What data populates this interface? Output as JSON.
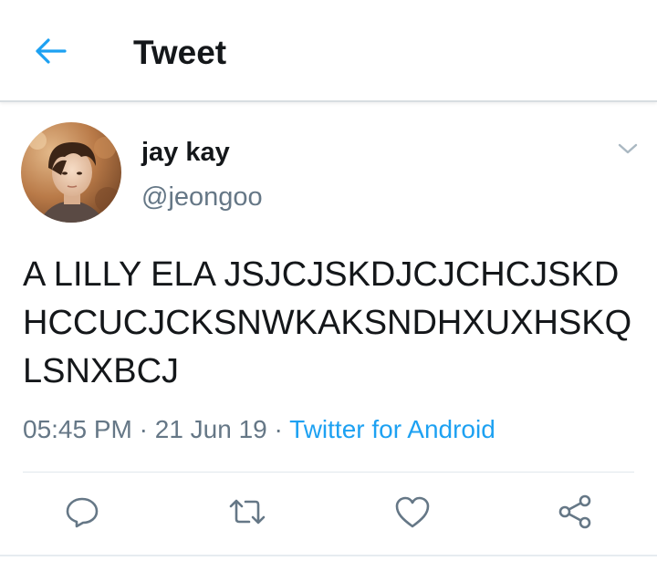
{
  "header": {
    "back_icon": "arrow-left-icon",
    "title": "Tweet"
  },
  "tweet": {
    "author": {
      "display_name": "jay kay",
      "handle": "@jeongoo",
      "avatar": "profile-photo"
    },
    "text": "A LILLY ELA JSJCJSKDJCJCHCJSKDHCCUCJCKSNWKAKSNDHXUXHSKQLSNXBCJ",
    "time": "05:45 PM",
    "separator": " · ",
    "date": "21 Jun 19",
    "source": "Twitter for Android",
    "menu_icon": "chevron-down-icon"
  },
  "actions": [
    {
      "icon": "reply-icon"
    },
    {
      "icon": "retweet-icon"
    },
    {
      "icon": "like-icon"
    },
    {
      "icon": "share-icon"
    }
  ],
  "colors": {
    "accent": "#1da1f2",
    "text": "#14171a",
    "secondary": "#657786"
  }
}
